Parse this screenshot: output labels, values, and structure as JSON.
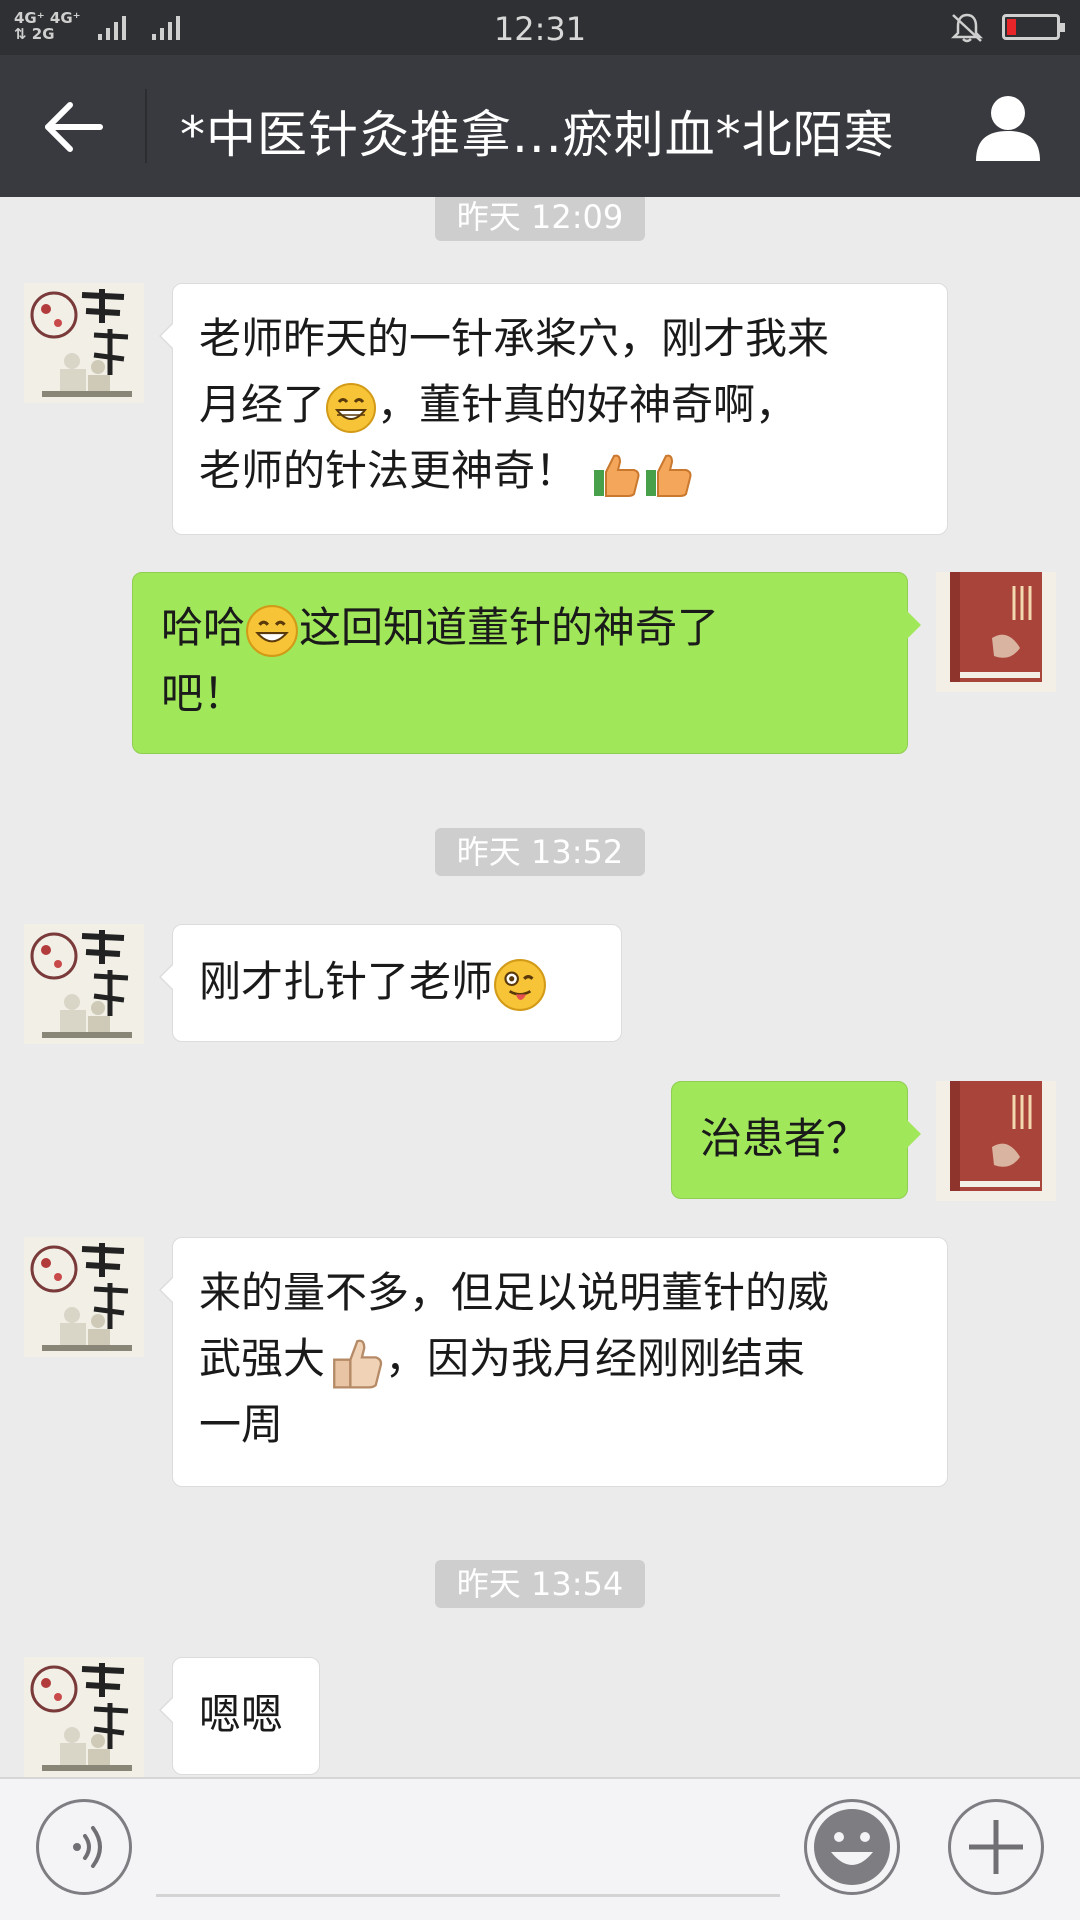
{
  "status_bar": {
    "network_top": "4G⁺ 4G⁺",
    "network_bottom": "⇅ 2G",
    "network_extra": "2G",
    "time": "12:31",
    "battery_color": "#e8262a"
  },
  "header": {
    "title": "*中医针灸推拿...瘀刺血*北陌寒",
    "back_icon": "arrow-left-icon",
    "profile_icon": "person-icon"
  },
  "messages": [
    {
      "type": "timestamp",
      "text": "昨天 12:09"
    },
    {
      "type": "left",
      "lines": [
        "老师昨天的一针承桨穴，刚才我来",
        "月经了[grin]，董针真的好神奇啊，",
        "老师的针法更神奇！ [thumb][thumb]"
      ]
    },
    {
      "type": "right",
      "lines": [
        "哈哈[smile]这回知道董针的神奇了",
        "吧！"
      ]
    },
    {
      "type": "timestamp",
      "text": "昨天 13:52"
    },
    {
      "type": "left",
      "lines": [
        "刚才扎针了老师[wink]"
      ]
    },
    {
      "type": "right",
      "lines": [
        "治患者？"
      ]
    },
    {
      "type": "left",
      "lines": [
        "来的量不多，但足以说明董针的威",
        "武强大[thumbskin]，因为我月经刚刚结束",
        "一周"
      ]
    },
    {
      "type": "timestamp",
      "text": "昨天 13:54"
    },
    {
      "type": "left",
      "lines": [
        "嗯嗯"
      ]
    }
  ],
  "avatars": {
    "left_text": "中医针灸",
    "right_text": "董氏奇穴实用手册"
  },
  "input_bar": {
    "voice_icon": "voice-icon",
    "emoji_icon": "emoji-icon",
    "plus_icon": "plus-icon"
  },
  "colors": {
    "header_bg": "#393a3f",
    "chat_bg": "#ebebeb",
    "sent_bubble": "#a0e75a",
    "received_bubble": "#ffffff"
  }
}
